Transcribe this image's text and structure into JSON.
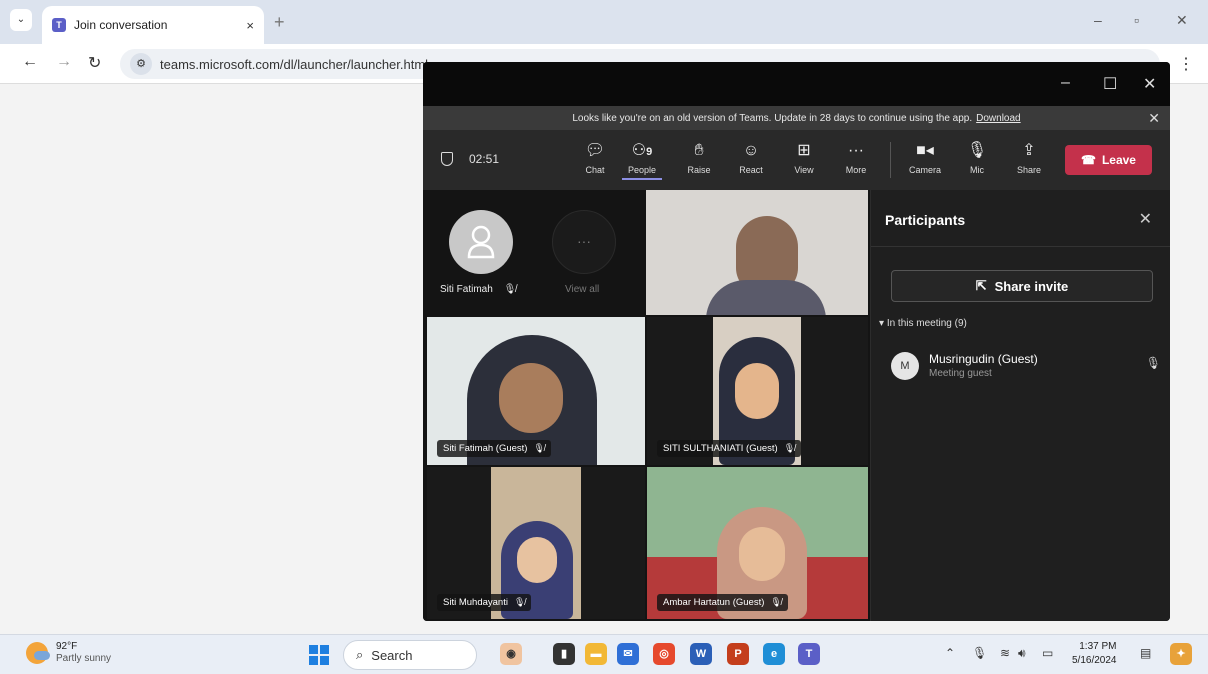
{
  "browser": {
    "tab_title": "Join conversation",
    "tab_close": "×",
    "new_tab": "+",
    "url": "teams.microsoft.com/dl/launcher/launcher.html"
  },
  "teams": {
    "update_text": "Looks like you're on an old version of Teams. Update in 28 days to continue using the app.",
    "update_link": "Download",
    "timer": "02:51",
    "toolbar": {
      "chat": "Chat",
      "people": "People",
      "people_count": "9",
      "raise": "Raise",
      "react": "React",
      "view": "View",
      "more": "More",
      "camera": "Camera",
      "mic": "Mic",
      "share": "Share",
      "leave": "Leave"
    },
    "stage": {
      "avatar_name": "Siti Fatimah",
      "view_all": "View all",
      "more_dots": "···",
      "videos": [
        {
          "name": ""
        },
        {
          "name": "Siti Fatimah (Guest)"
        },
        {
          "name": "SITI SULTHANIATI (Guest)"
        },
        {
          "name": "Siti Muhdayanti"
        },
        {
          "name": "Ambar Hartatun (Guest)"
        }
      ]
    },
    "panel": {
      "title": "Participants",
      "share_invite": "Share invite",
      "in_meeting": "In this meeting (9)",
      "participants": [
        {
          "initial": "M",
          "name": "Musringudin (Guest)",
          "role": "Meeting guest"
        }
      ]
    }
  },
  "taskbar": {
    "temp": "92°F",
    "weather": "Partly sunny",
    "search": "Search",
    "time": "1:37 PM",
    "date": "5/16/2024"
  }
}
